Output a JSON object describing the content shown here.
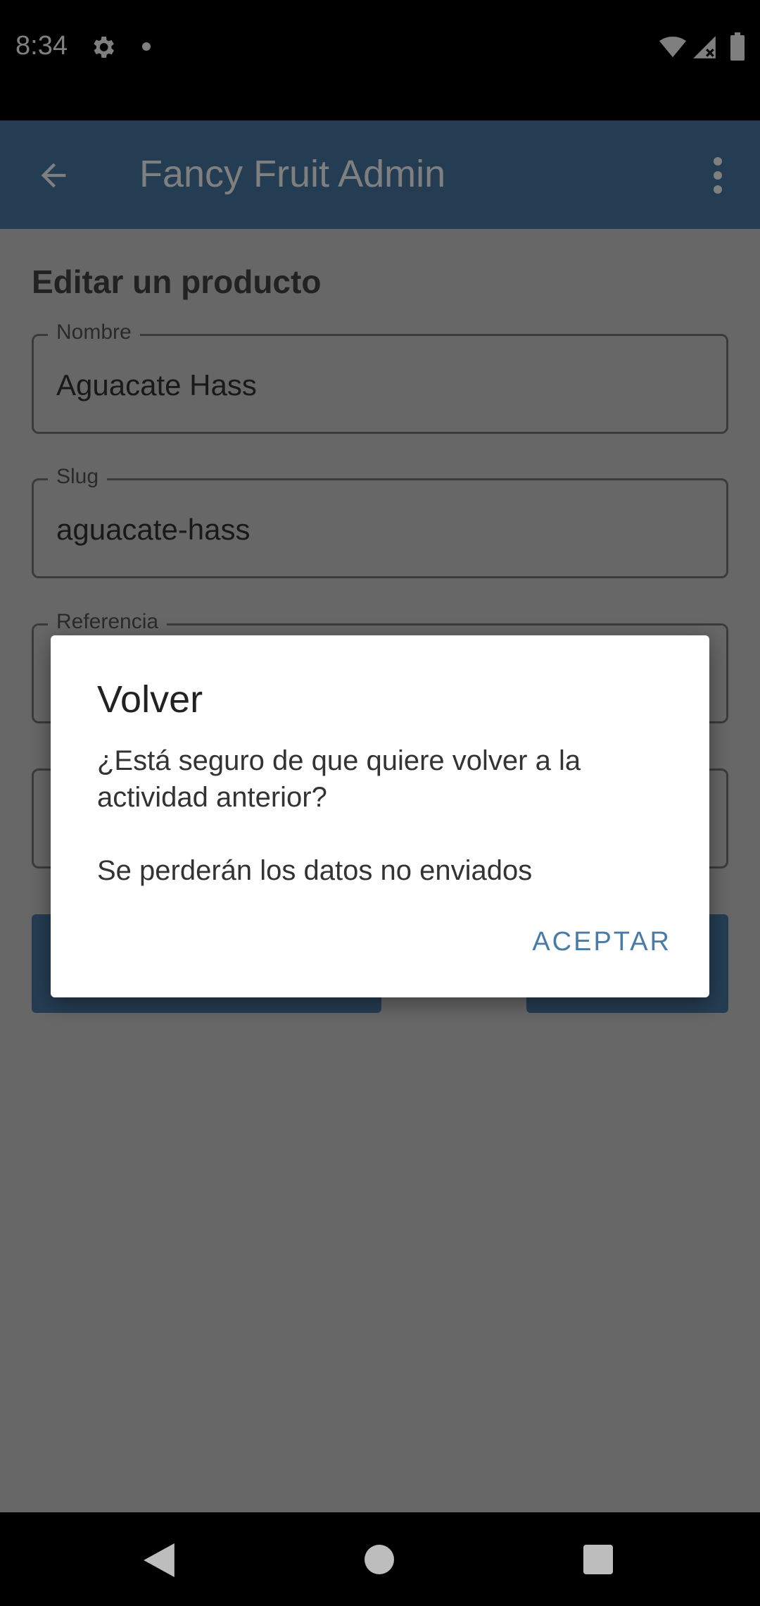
{
  "status_bar": {
    "time": "8:34",
    "icons": [
      "gear-icon",
      "dot-icon",
      "wifi-icon",
      "signal-icon",
      "battery-icon"
    ]
  },
  "app_bar": {
    "title": "Fancy Fruit Admin",
    "icons": [
      "back-arrow-icon",
      "more-vert-icon"
    ],
    "color": "#4a7ba7"
  },
  "page": {
    "title": "Editar un producto",
    "fields": [
      {
        "label": "Nombre",
        "value": "Aguacate Hass"
      },
      {
        "label": "Slug",
        "value": "aguacate-hass"
      },
      {
        "label": "Referencia",
        "value": ""
      },
      {
        "label": "",
        "value": ""
      }
    ]
  },
  "dialog": {
    "title": "Volver",
    "message": "¿Está seguro de que quiere volver a la actividad anterior?\n\nSe perderán los datos no enviados",
    "action_label": "ACEPTAR"
  },
  "nav_bar": {
    "icons": [
      "nav-back-icon",
      "nav-home-icon",
      "nav-recents-icon"
    ]
  }
}
